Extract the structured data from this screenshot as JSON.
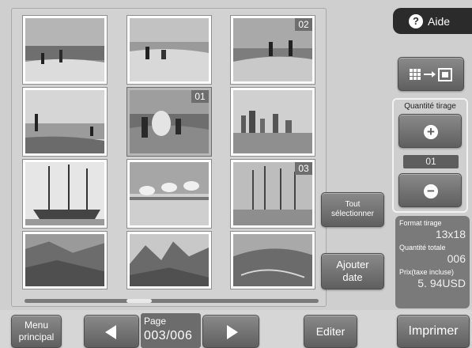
{
  "help": {
    "label": "Aide",
    "icon": "question-icon"
  },
  "view_toggle": {
    "icon": "grid-to-single-view-icon"
  },
  "quantity": {
    "title": "Quantité tirage",
    "value": "01",
    "plus_icon": "plus-icon",
    "minus_icon": "minus-icon"
  },
  "info": {
    "format_label": "Format tirage",
    "format_value": "13x18",
    "total_label": "Quantité totale",
    "total_value": "006",
    "price_label": "Prix(taxe incluse)",
    "price_value": "5. 94USD"
  },
  "side_buttons": {
    "select_all": [
      "Tout",
      "sélectionner"
    ],
    "add_date": [
      "Ajouter",
      "date"
    ]
  },
  "thumbnails": [
    {
      "subject": "children-on-beach",
      "badge": ""
    },
    {
      "subject": "children-playing-in-surf",
      "badge": ""
    },
    {
      "subject": "children-at-shore",
      "badge": "02"
    },
    {
      "subject": "figures-on-seashore",
      "badge": ""
    },
    {
      "subject": "family-on-beach",
      "badge": "01"
    },
    {
      "subject": "city-skyline",
      "badge": ""
    },
    {
      "subject": "tall-ship",
      "badge": ""
    },
    {
      "subject": "seagulls-on-rail",
      "badge": ""
    },
    {
      "subject": "bare-trees-winter",
      "badge": "03"
    },
    {
      "subject": "mountain-valley",
      "badge": ""
    },
    {
      "subject": "rocky-mountains",
      "badge": ""
    },
    {
      "subject": "hillside-trail",
      "badge": ""
    }
  ],
  "scroll": {
    "position": 0.38
  },
  "footer": {
    "menu_label": [
      "Menu",
      "principal"
    ],
    "page_label": "Page",
    "page_number": "003/006",
    "edit_label": "Editer",
    "print_label": "Imprimer"
  }
}
